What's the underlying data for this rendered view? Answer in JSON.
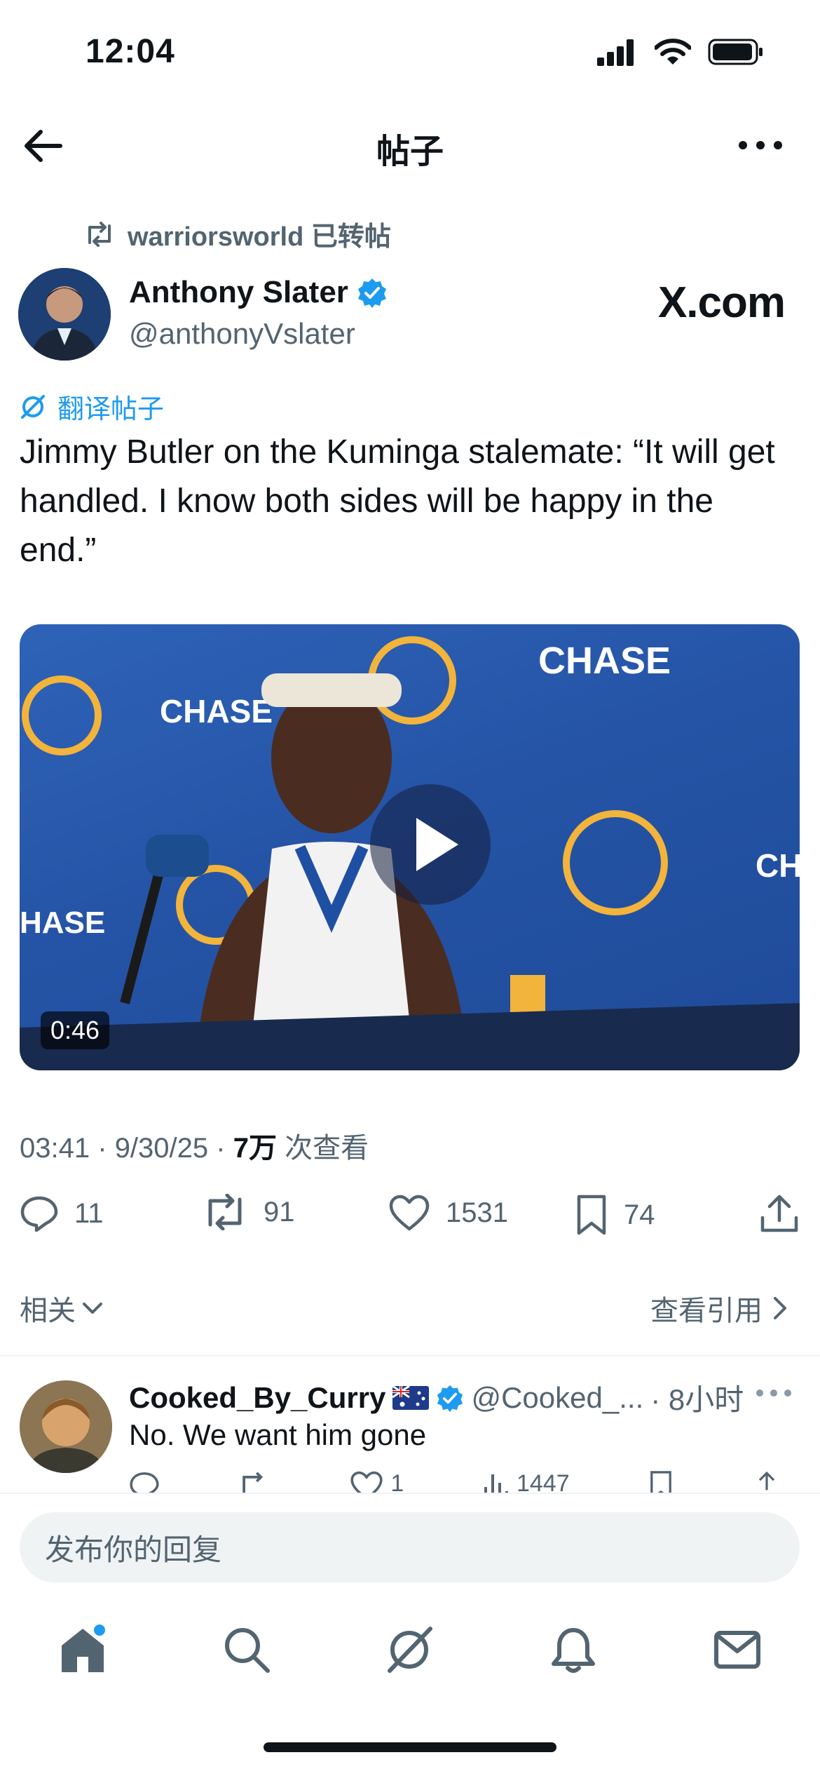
{
  "status_bar": {
    "time": "12:04"
  },
  "header": {
    "title": "帖子"
  },
  "repost": {
    "text": "warriorsworld 已转帖"
  },
  "author": {
    "name": "Anthony Slater",
    "handle": "@anthonyVslater"
  },
  "watermark": "X.com",
  "translate_label": "翻译帖子",
  "post": {
    "text": "Jimmy Butler on the Kuminga stalemate: “It will get handled. I know both sides will be happy in the end.”"
  },
  "video": {
    "duration": "0:46"
  },
  "meta": {
    "time": "03:41",
    "date": "9/30/25",
    "views_count": "7万",
    "views_label": "次查看",
    "sep": "·"
  },
  "actions": {
    "replies": "11",
    "reposts": "91",
    "likes": "1531",
    "bookmarks": "74"
  },
  "related_label": "相关",
  "view_quotes_label": "查看引用",
  "reply": {
    "name": "Cooked_By_Curry",
    "handle": "@Cooked_...",
    "time": "· 8小时",
    "text": "No. We want him gone",
    "likes": "1",
    "views": "1447"
  },
  "composer": {
    "placeholder": "发布你的回复"
  },
  "colors": {
    "accent": "#1d9bf0",
    "text": "#0f1419",
    "muted": "#536471"
  },
  "tabs": [
    "home-icon",
    "search-icon",
    "grok-icon",
    "bell-icon",
    "mail-icon"
  ]
}
